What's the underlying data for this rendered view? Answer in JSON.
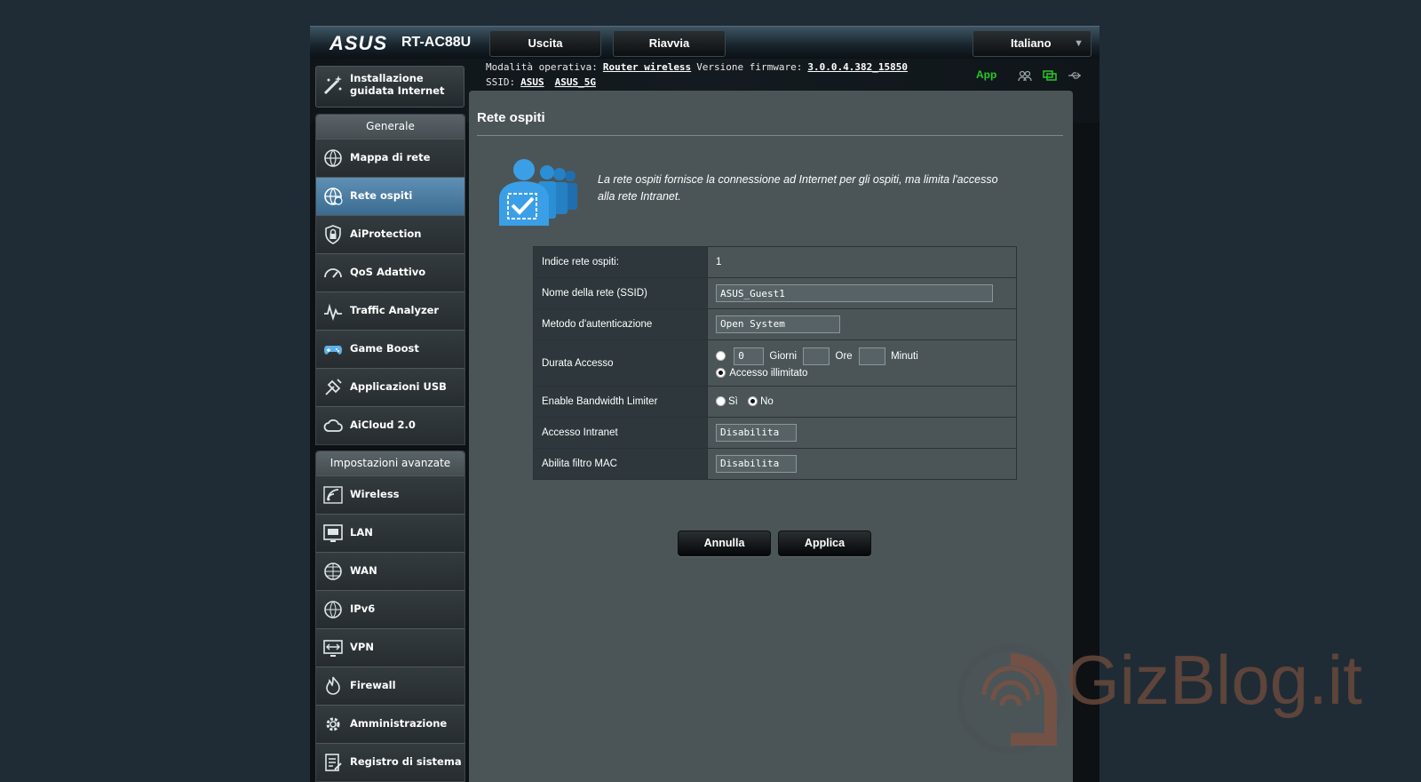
{
  "header": {
    "brand": "ASUS",
    "model": "RT-AC88U",
    "logout_label": "Uscita",
    "reboot_label": "Riavvia",
    "language": "Italiano"
  },
  "status": {
    "mode_label": "Modalità operativa:",
    "mode_value": "Router wireless",
    "firmware_label": "Versione firmware:",
    "firmware_value": "3.0.0.4.382_15850",
    "ssid_label": "SSID:",
    "ssid_values": [
      "ASUS",
      "ASUS_5G"
    ],
    "app_label": "App",
    "icons": [
      "clients-icon",
      "network-status-icon",
      "usb-icon"
    ]
  },
  "sidebar": {
    "qis_label": "Installazione guidata Internet",
    "general_header": "Generale",
    "general_items": [
      {
        "label": "Mappa di rete",
        "icon": "network-map-icon"
      },
      {
        "label": "Rete ospiti",
        "icon": "guest-network-icon",
        "active": true
      },
      {
        "label": "AiProtection",
        "icon": "lock-shield-icon"
      },
      {
        "label": "QoS Adattivo",
        "icon": "speedometer-icon"
      },
      {
        "label": "Traffic Analyzer",
        "icon": "traffic-icon"
      },
      {
        "label": "Game Boost",
        "icon": "gamepad-icon"
      },
      {
        "label": "Applicazioni USB",
        "icon": "usb-app-icon"
      },
      {
        "label": "AiCloud 2.0",
        "icon": "cloud-icon"
      }
    ],
    "advanced_header": "Impostazioni avanzate",
    "advanced_items": [
      {
        "label": "Wireless",
        "icon": "wireless-icon"
      },
      {
        "label": "LAN",
        "icon": "lan-icon"
      },
      {
        "label": "WAN",
        "icon": "wan-icon"
      },
      {
        "label": "IPv6",
        "icon": "ipv6-icon"
      },
      {
        "label": "VPN",
        "icon": "vpn-icon"
      },
      {
        "label": "Firewall",
        "icon": "firewall-icon"
      },
      {
        "label": "Amministrazione",
        "icon": "gear-icon"
      },
      {
        "label": "Registro di sistema",
        "icon": "log-icon"
      }
    ]
  },
  "main": {
    "title": "Rete ospiti",
    "intro": "La rete ospiti fornisce la connessione ad Internet per gli ospiti, ma limita l'accesso alla rete Intranet.",
    "form": {
      "index_label": "Indice rete ospiti:",
      "index_value": "1",
      "ssid_label": "Nome della rete (SSID)",
      "ssid_value": "ASUS_Guest1",
      "auth_label": "Metodo d'autenticazione",
      "auth_value": "Open System",
      "duration_label": "Durata Accesso",
      "days_value": "0",
      "days_label": "Giorni",
      "hours_label": "Ore",
      "minutes_label": "Minuti",
      "unlimited_label": "Accesso illimitato",
      "bw_label": "Enable Bandwidth Limiter",
      "bw_yes": "Sì",
      "bw_no": "No",
      "intranet_label": "Accesso Intranet",
      "intranet_value": "Disabilita",
      "mac_label": "Abilita filtro MAC",
      "mac_value": "Disabilita"
    },
    "cancel_label": "Annulla",
    "apply_label": "Applica"
  },
  "watermark": "GizBlog.it",
  "colors": {
    "active_menu": "#4a7ba2",
    "app_green": "#28c828",
    "accent_blue": "#2f8fd6"
  }
}
